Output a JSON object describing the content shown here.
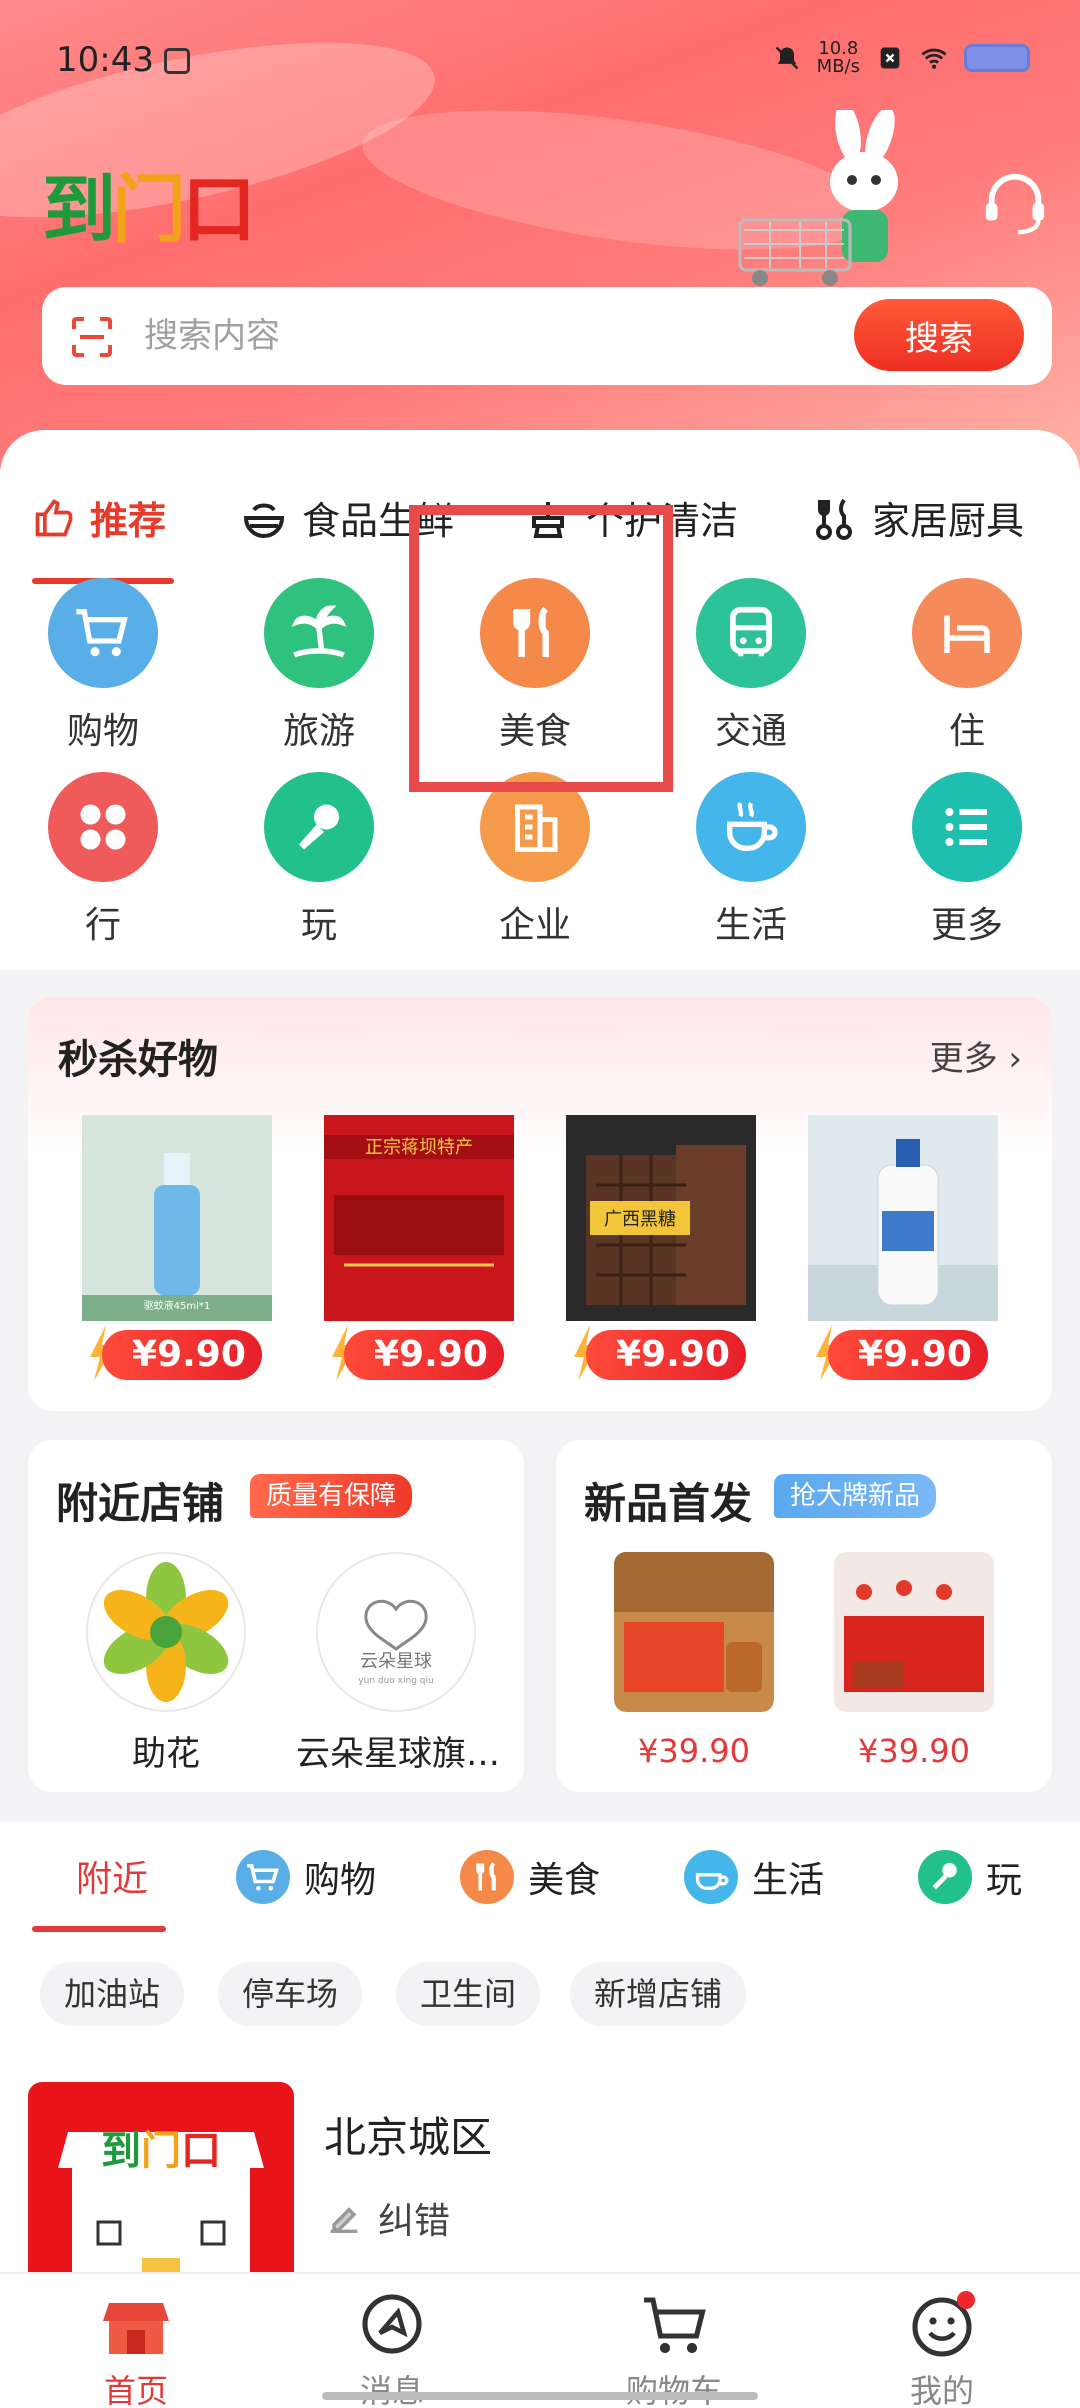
{
  "status_bar": {
    "time": "10:43",
    "speed": "10.8",
    "speed_unit": "MB/s"
  },
  "header": {
    "logo": [
      "到",
      "门",
      "口"
    ],
    "search": {
      "placeholder": "搜索内容",
      "button": "搜索"
    }
  },
  "category_tabs": [
    {
      "label": "推荐",
      "icon": "thumbs-up-icon",
      "active": true
    },
    {
      "label": "食品生鲜",
      "icon": "bowl-icon"
    },
    {
      "label": "个护清洁",
      "icon": "cleaning-icon"
    },
    {
      "label": "家居厨具",
      "icon": "kitchen-icon"
    }
  ],
  "service_grid": [
    {
      "label": "购物",
      "icon": "cart-icon",
      "color": "#5aaee8"
    },
    {
      "label": "旅游",
      "icon": "palm-tree-icon",
      "color": "#2ec27e"
    },
    {
      "label": "美食",
      "icon": "fork-knife-icon",
      "color": "#f5894a"
    },
    {
      "label": "交通",
      "icon": "bus-icon",
      "color": "#2ec29a"
    },
    {
      "label": "住",
      "icon": "bed-icon",
      "color": "#f58a5a"
    },
    {
      "label": "行",
      "icon": "clover-icon",
      "color": "#ef5a5a"
    },
    {
      "label": "玩",
      "icon": "microphone-icon",
      "color": "#22c08a"
    },
    {
      "label": "企业",
      "icon": "building-icon",
      "color": "#f59a4a"
    },
    {
      "label": "生活",
      "icon": "coffee-cup-icon",
      "color": "#45b6ea"
    },
    {
      "label": "更多",
      "icon": "list-icon",
      "color": "#1fbfb0"
    }
  ],
  "flash_sale": {
    "title": "秒杀好物",
    "more": "更多",
    "items": [
      {
        "price": "¥9.90",
        "img": "spray-bottle",
        "img_text": "驱蚊液45ml*1"
      },
      {
        "price": "¥9.90",
        "img": "red-box",
        "img_text": "正宗蒋坝特产"
      },
      {
        "price": "¥9.90",
        "img": "brown-sugar",
        "img_text": "广西黑糖"
      },
      {
        "price": "¥9.90",
        "img": "bleach-bottle",
        "img_text": ""
      }
    ]
  },
  "nearby_shops": {
    "title": "附近店铺",
    "badge": "质量有保障",
    "shops": [
      {
        "name": "助花"
      },
      {
        "name": "云朵星球旗…",
        "logo_text": "云朵星球",
        "logo_sub": "yun duo xing qiu"
      }
    ]
  },
  "new_products": {
    "title": "新品首发",
    "badge": "抢大牌新品",
    "items": [
      {
        "price": "¥39.90"
      },
      {
        "price": "¥39.90"
      }
    ]
  },
  "nearby_tabs": [
    {
      "label": "附近",
      "active": true
    },
    {
      "label": "购物",
      "icon": "cart-icon",
      "color": "#5aaee8"
    },
    {
      "label": "美食",
      "icon": "fork-knife-icon",
      "color": "#f5894a"
    },
    {
      "label": "生活",
      "icon": "coffee-cup-icon",
      "color": "#45b6ea"
    },
    {
      "label": "玩",
      "icon": "microphone-icon",
      "color": "#22c08a"
    }
  ],
  "chips": [
    "加油站",
    "停车场",
    "卫生间",
    "新增店铺"
  ],
  "store": {
    "name": "北京城区",
    "correct": "纠错"
  },
  "bottom_nav": [
    {
      "label": "首页",
      "icon": "store-icon",
      "active": true
    },
    {
      "label": "消息",
      "icon": "message-icon"
    },
    {
      "label": "购物车",
      "icon": "cart-icon"
    },
    {
      "label": "我的",
      "icon": "smile-icon"
    }
  ],
  "colors": {
    "brand": "#e83a2a",
    "highlight": "#e84a4a"
  }
}
